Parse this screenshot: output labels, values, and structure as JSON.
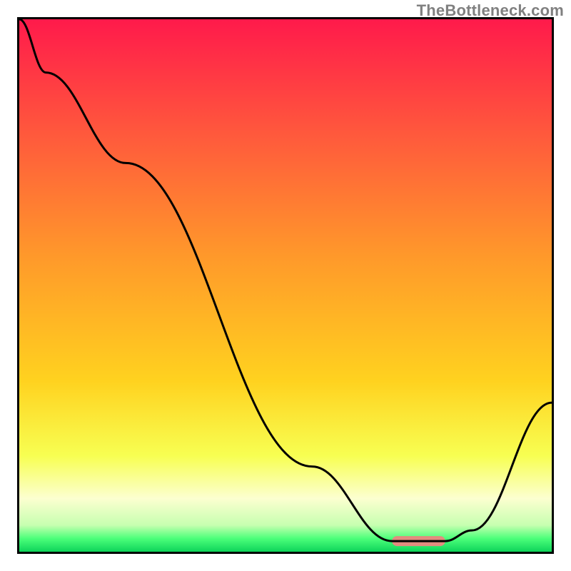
{
  "watermark": {
    "text": "TheBottleneck.com"
  },
  "chart_data": {
    "type": "line",
    "title": "",
    "xlabel": "",
    "ylabel": "",
    "xlim": [
      0,
      1
    ],
    "ylim": [
      0,
      1
    ],
    "x": [
      0.0,
      0.05,
      0.2,
      0.55,
      0.7,
      0.8,
      0.85,
      1.0
    ],
    "values": [
      1.0,
      0.9,
      0.73,
      0.16,
      0.02,
      0.02,
      0.04,
      0.28
    ],
    "optimum_band": {
      "x_start": 0.7,
      "x_end": 0.8,
      "y": 0.02
    },
    "background_gradient": {
      "stops": [
        {
          "pos": 0.0,
          "color": "#ff1a4b"
        },
        {
          "pos": 0.22,
          "color": "#ff5a3c"
        },
        {
          "pos": 0.45,
          "color": "#ff9a2a"
        },
        {
          "pos": 0.68,
          "color": "#ffd21f"
        },
        {
          "pos": 0.82,
          "color": "#f7ff52"
        },
        {
          "pos": 0.9,
          "color": "#fcffd0"
        },
        {
          "pos": 0.95,
          "color": "#c7ffb0"
        },
        {
          "pos": 0.975,
          "color": "#4cff7a"
        },
        {
          "pos": 1.0,
          "color": "#0ed45a"
        }
      ]
    },
    "line_color": "#000000",
    "frame_color": "#000000",
    "optimum_marker_color": "#e38b7f"
  }
}
